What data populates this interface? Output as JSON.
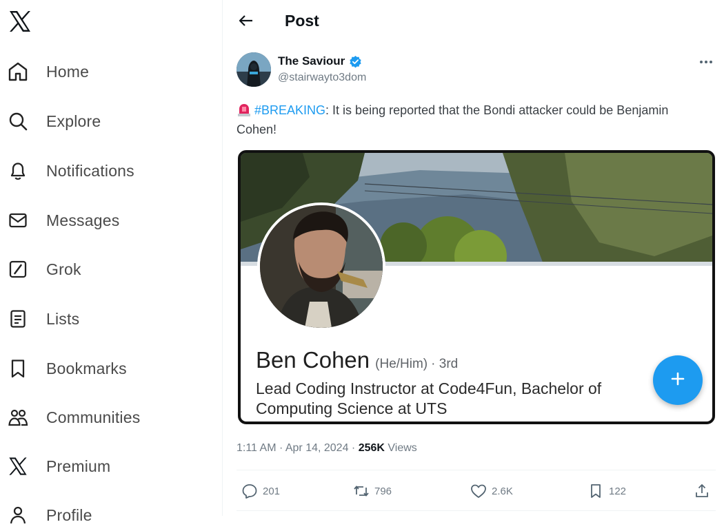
{
  "sidebar": {
    "logo": "x-logo-icon",
    "items": [
      {
        "label": "Home",
        "icon": "home-icon"
      },
      {
        "label": "Explore",
        "icon": "search-icon"
      },
      {
        "label": "Notifications",
        "icon": "bell-icon"
      },
      {
        "label": "Messages",
        "icon": "envelope-icon"
      },
      {
        "label": "Grok",
        "icon": "grok-icon"
      },
      {
        "label": "Lists",
        "icon": "list-icon"
      },
      {
        "label": "Bookmarks",
        "icon": "bookmark-icon"
      },
      {
        "label": "Communities",
        "icon": "communities-icon"
      },
      {
        "label": "Premium",
        "icon": "x-logo-icon"
      },
      {
        "label": "Profile",
        "icon": "profile-icon"
      }
    ]
  },
  "header": {
    "title": "Post",
    "back_icon": "back-arrow-icon"
  },
  "post": {
    "author": {
      "name": "The Saviour",
      "handle": "@stairwayto3dom",
      "verified": true
    },
    "text": {
      "hashtag": "#BREAKING",
      "body": ": It is being reported that the Bondi attacker could be Benjamin Cohen!"
    },
    "media": {
      "name": "Ben Cohen",
      "pronouns": "(He/Him)",
      "degree": "· 3rd",
      "headline": "Lead Coding Instructor at Code4Fun, Bachelor of Computing Science at UTS"
    },
    "meta": {
      "time_date": "1:11 AM · Apr 14, 2024 · ",
      "views_count": "256K",
      "views_label": " Views"
    },
    "actions": {
      "replies": "201",
      "reposts": "796",
      "likes": "2.6K",
      "bookmarks": "122"
    }
  },
  "colors": {
    "accent": "#1d9bf0",
    "text_primary": "#0f1419",
    "text_secondary": "#6f7a84"
  }
}
